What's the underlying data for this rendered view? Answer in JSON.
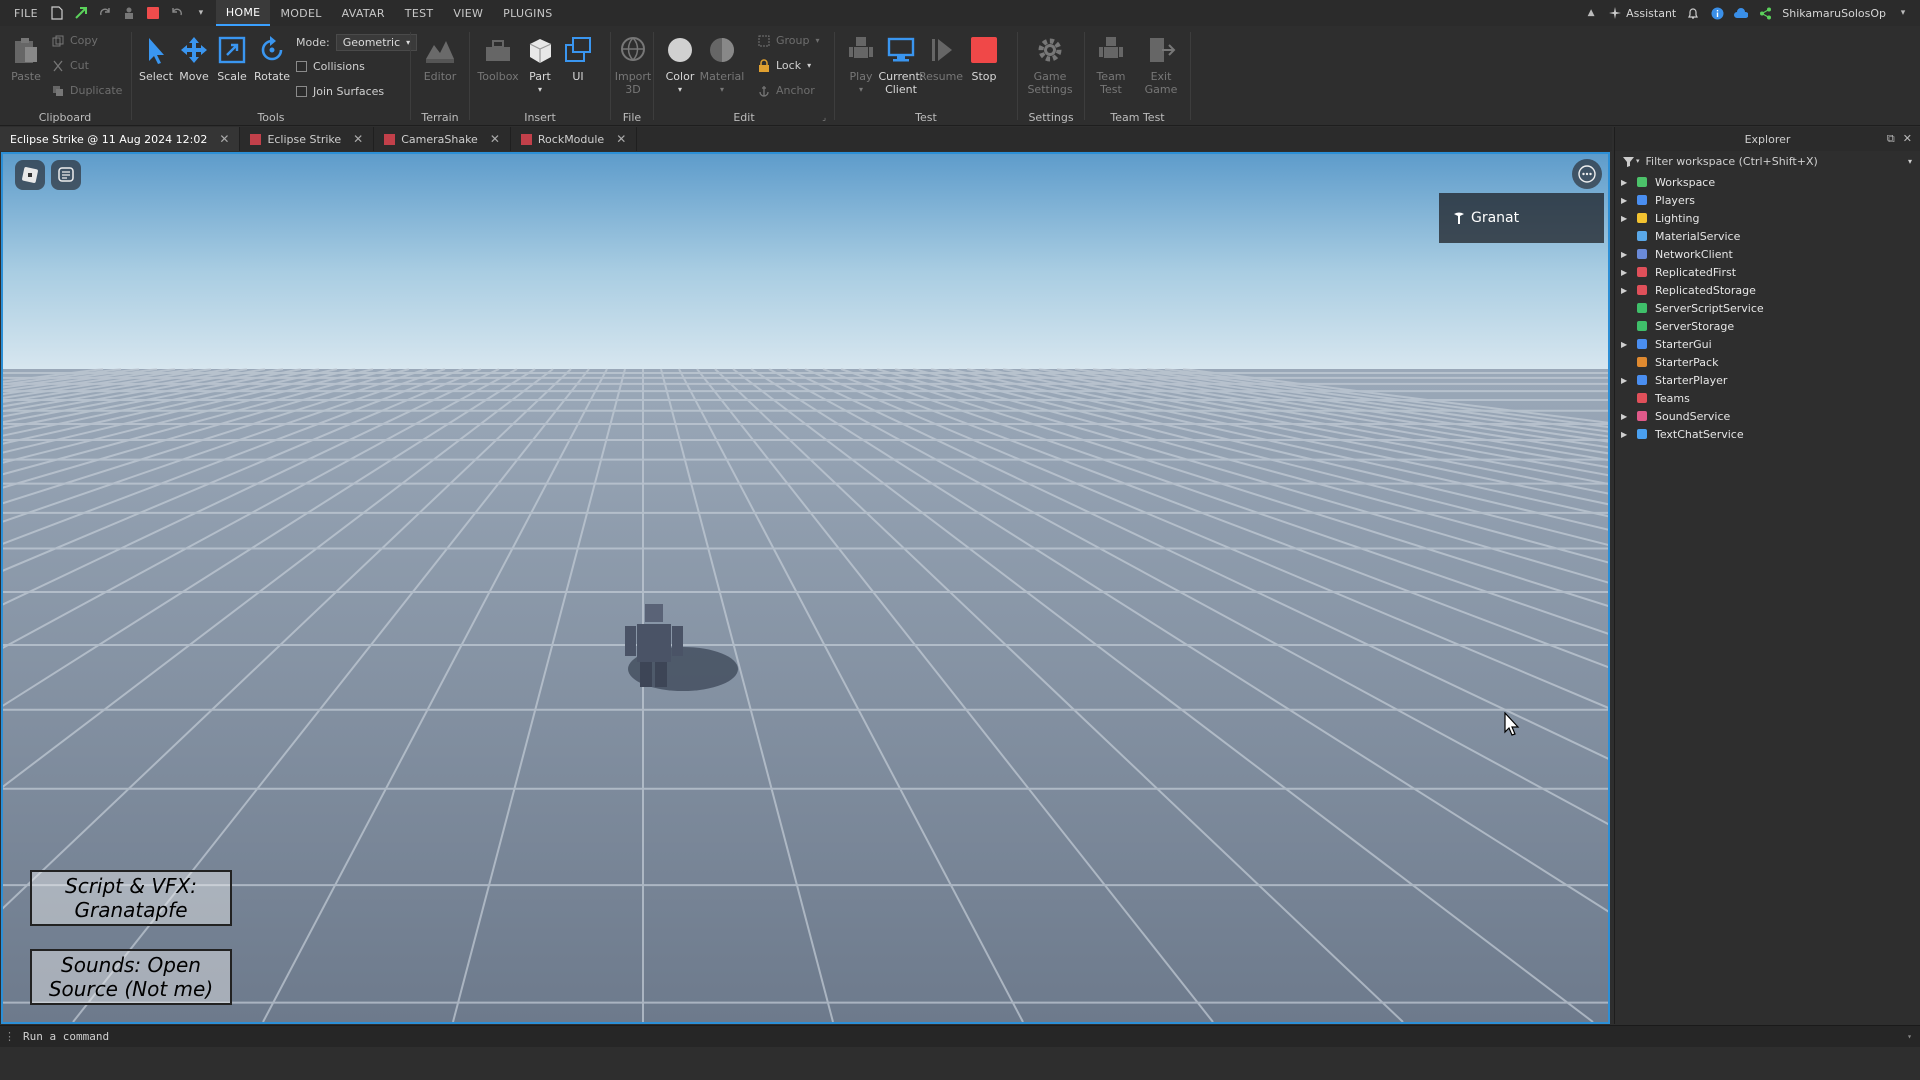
{
  "menubar": {
    "items": [
      "FILE",
      "HOME",
      "MODEL",
      "AVATAR",
      "TEST",
      "VIEW",
      "PLUGINS"
    ],
    "active": "HOME",
    "assistant_label": "Assistant",
    "username": "ShikamaruSolosOp"
  },
  "ribbon": {
    "clipboard": {
      "paste": "Paste",
      "copy": "Copy",
      "cut": "Cut",
      "duplicate": "Duplicate",
      "label": "Clipboard"
    },
    "tools": {
      "select": "Select",
      "move": "Move",
      "scale": "Scale",
      "rotate": "Rotate",
      "mode_label": "Mode:",
      "mode_value": "Geometric",
      "collisions": "Collisions",
      "join_surfaces": "Join Surfaces",
      "label": "Tools"
    },
    "terrain": {
      "editor": "Editor",
      "label": "Terrain"
    },
    "insert": {
      "toolbox": "Toolbox",
      "part": "Part",
      "ui": "UI",
      "label": "Insert"
    },
    "file": {
      "import3d": "Import 3D",
      "label": "File"
    },
    "edit": {
      "color": "Color",
      "material": "Material",
      "group": "Group",
      "lock": "Lock",
      "anchor": "Anchor",
      "label": "Edit"
    },
    "test": {
      "play": "Play",
      "current_client": "Current: Client",
      "resume": "Resume",
      "stop": "Stop",
      "label": "Test"
    },
    "settings": {
      "game_settings": "Game Settings",
      "label": "Settings"
    },
    "team_test": {
      "team_test": "Team Test",
      "exit_game": "Exit Game",
      "label": "Team Test"
    }
  },
  "tabs": [
    {
      "label": "Eclipse Strike @ 11 Aug 2024 12:02",
      "active": true,
      "icon": false
    },
    {
      "label": "Eclipse Strike",
      "active": false,
      "icon": true
    },
    {
      "label": "CameraShake",
      "active": false,
      "icon": true
    },
    {
      "label": "RockModule",
      "active": false,
      "icon": true
    }
  ],
  "viewport": {
    "player_name": "Granat",
    "credit_script": "Script & VFX: Granatapfe",
    "credit_sounds": "Sounds: Open Source (Not me)"
  },
  "explorer": {
    "title": "Explorer",
    "filter_placeholder": "Filter workspace (Ctrl+Shift+X)",
    "items": [
      {
        "label": "Workspace",
        "expandable": true,
        "icon": "workspace-icon",
        "color": "#4cc26a"
      },
      {
        "label": "Players",
        "expandable": true,
        "icon": "players-icon",
        "color": "#4a8ef0"
      },
      {
        "label": "Lighting",
        "expandable": true,
        "icon": "lighting-icon",
        "color": "#f2c230"
      },
      {
        "label": "MaterialService",
        "expandable": false,
        "icon": "material-service-icon",
        "color": "#5aa8e8"
      },
      {
        "label": "NetworkClient",
        "expandable": true,
        "icon": "network-client-icon",
        "color": "#6a8ad8"
      },
      {
        "label": "ReplicatedFirst",
        "expandable": true,
        "icon": "replicated-first-icon",
        "color": "#e0505a"
      },
      {
        "label": "ReplicatedStorage",
        "expandable": true,
        "icon": "replicated-storage-icon",
        "color": "#e0505a"
      },
      {
        "label": "ServerScriptService",
        "expandable": false,
        "icon": "server-script-service-icon",
        "color": "#3fbf6a"
      },
      {
        "label": "ServerStorage",
        "expandable": false,
        "icon": "server-storage-icon",
        "color": "#3fbf6a"
      },
      {
        "label": "StarterGui",
        "expandable": true,
        "icon": "starter-gui-icon",
        "color": "#4a8ef0"
      },
      {
        "label": "StarterPack",
        "expandable": false,
        "icon": "starter-pack-icon",
        "color": "#e08a30"
      },
      {
        "label": "StarterPlayer",
        "expandable": true,
        "icon": "starter-player-icon",
        "color": "#4a8ef0"
      },
      {
        "label": "Teams",
        "expandable": false,
        "icon": "teams-icon",
        "color": "#e0505a"
      },
      {
        "label": "SoundService",
        "expandable": true,
        "icon": "sound-service-icon",
        "color": "#e05a8a"
      },
      {
        "label": "TextChatService",
        "expandable": true,
        "icon": "text-chat-service-icon",
        "color": "#4aa0f0"
      }
    ]
  },
  "command_bar": {
    "placeholder": "Run a command"
  }
}
